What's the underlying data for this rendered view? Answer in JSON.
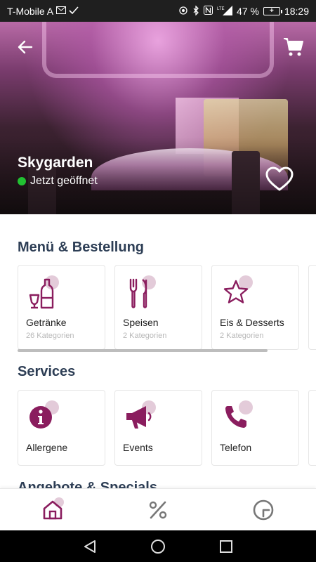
{
  "status_bar": {
    "carrier": "T-Mobile A",
    "battery_percent": "47 %",
    "time": "18:29",
    "network_label": "LTE"
  },
  "hero": {
    "venue_name": "Skygarden",
    "open_status": "Jetzt geöffnet",
    "open_status_color": "#21c132"
  },
  "menu_section": {
    "title": "Menü & Bestellung",
    "cards": [
      {
        "label": "Getränke",
        "sub": "26 Kategorien",
        "icon": "drinks-icon"
      },
      {
        "label": "Speisen",
        "sub": "2 Kategorien",
        "icon": "cutlery-icon"
      },
      {
        "label": "Eis & Desserts",
        "sub": "2 Kategorien",
        "icon": "star-icon"
      }
    ]
  },
  "services_section": {
    "title": "Services",
    "cards": [
      {
        "label": "Allergene",
        "icon": "info-icon"
      },
      {
        "label": "Events",
        "icon": "megaphone-icon"
      },
      {
        "label": "Telefon",
        "icon": "phone-icon"
      }
    ]
  },
  "offers_section": {
    "title": "Angebote & Specials"
  },
  "bottom_nav": {
    "items": [
      "home-icon",
      "percent-icon",
      "clock-icon"
    ],
    "active": "home-icon"
  },
  "colors": {
    "accent": "#8a1d5e",
    "accent_light": "#e3cbd9",
    "heading": "#2d3e55"
  }
}
